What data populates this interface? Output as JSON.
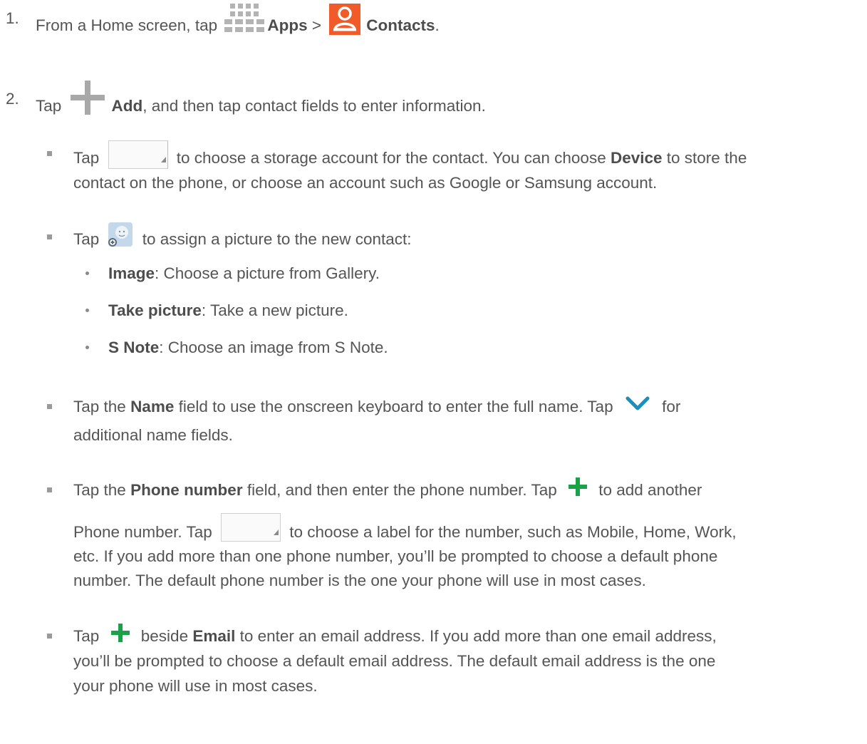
{
  "step1": {
    "number": "1.",
    "t1": "From a Home screen, tap ",
    "apps": "Apps",
    "t2": " > ",
    "contacts": "Contacts",
    "t3": "."
  },
  "step2": {
    "number": "2.",
    "t1": "Tap ",
    "add": "Add",
    "t2": ", and then tap contact fields to enter information."
  },
  "storage": {
    "l1a": "Tap ",
    "l1b": " to choose a storage account for the contact. You can choose ",
    "device": "Device",
    "l1c": " to store the",
    "l2": "contact on the phone, or choose an account such as Google or Samsung account."
  },
  "picture": {
    "a": "Tap ",
    "b": " to assign a picture to the new contact:",
    "options": [
      {
        "bold": "Image",
        "text": ": Choose a picture from Gallery."
      },
      {
        "bold": "Take picture",
        "text": ": Take a new picture."
      },
      {
        "bold": "S Note",
        "text": ": Choose an image from S Note."
      }
    ]
  },
  "name": {
    "a": "Tap the ",
    "bold": "Name",
    "b": " field to use the onscreen keyboard to enter the full name. Tap ",
    "c": " for",
    "l2": "additional name fields."
  },
  "phone": {
    "a": "Tap the ",
    "bold": "Phone number",
    "b": " field, and then enter the phone number. Tap ",
    "c": " to add another",
    "l2a": "Phone number. Tap ",
    "l2b": " to choose a label for the number, such as Mobile, Home, Work,",
    "l3": "etc. If you add more than one phone number, you’ll be prompted to choose a default phone",
    "l4": "number. The default phone number is the one your phone will use in most cases."
  },
  "email": {
    "a": "Tap ",
    "b": " beside ",
    "bold": "Email",
    "c": " to enter an email address. If you add more than one email address,",
    "l2": "you’ll be prompted to choose a default email address. The default email address is the one",
    "l3": "your phone will use in most cases."
  },
  "colors": {
    "text": "#555555",
    "contacts_icon": "#f15a29",
    "plus_green": "#1aa24a",
    "chevron_blue": "#1a8fb8",
    "icon_gray": "#b3b3b3"
  }
}
